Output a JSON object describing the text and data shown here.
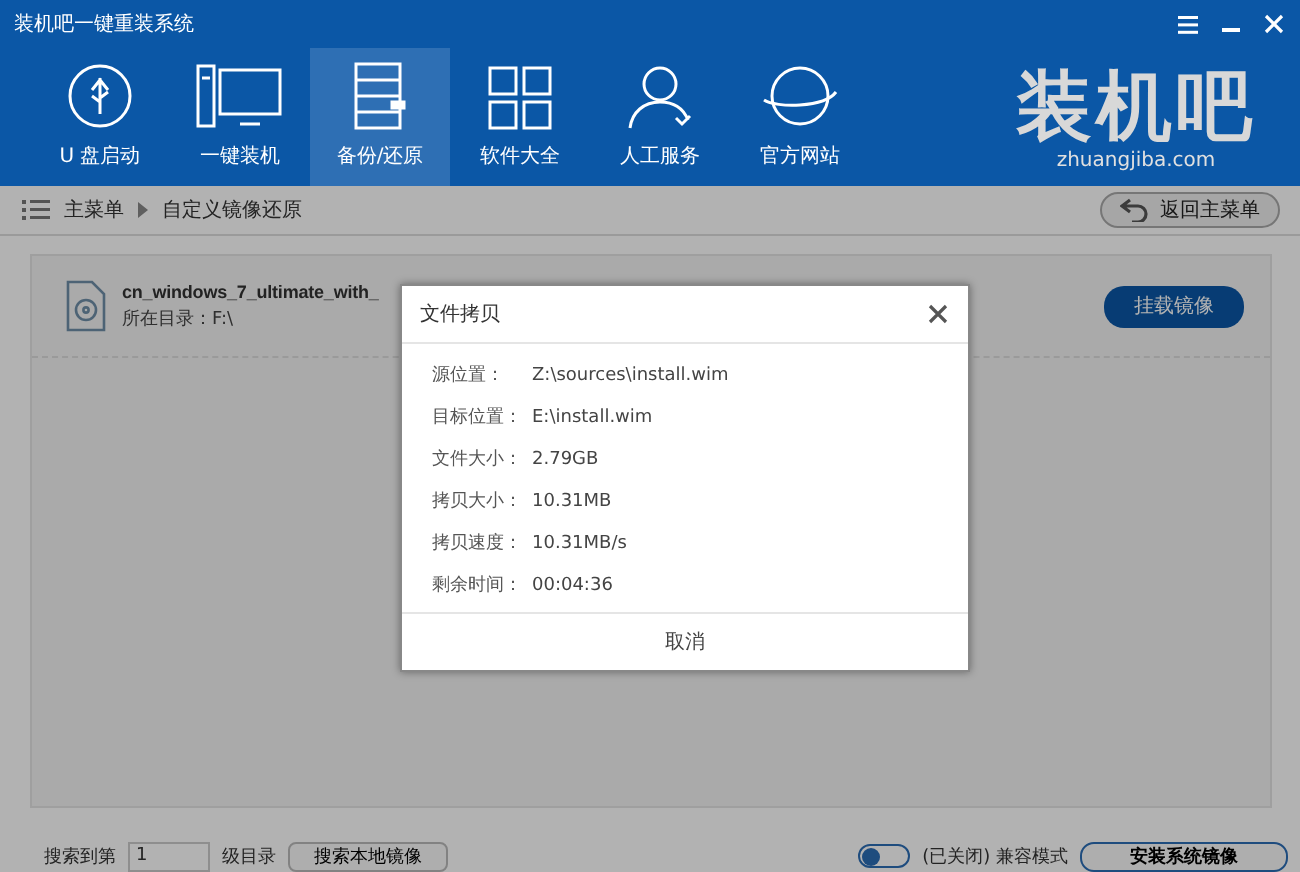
{
  "window": {
    "title": "装机吧一键重装系统"
  },
  "nav": [
    {
      "label": "U 盘启动",
      "selected": false
    },
    {
      "label": "一键装机",
      "selected": false
    },
    {
      "label": "备份/还原",
      "selected": true
    },
    {
      "label": "软件大全",
      "selected": false
    },
    {
      "label": "人工服务",
      "selected": false
    },
    {
      "label": "官方网站",
      "selected": false
    }
  ],
  "logo": {
    "name": "装机吧",
    "site": "zhuangjiba.com"
  },
  "breadcrumb": {
    "items": [
      "主菜单",
      "自定义镜像还原"
    ],
    "back_button": "返回主菜单"
  },
  "image_item": {
    "name": "cn_windows_7_ultimate_with_",
    "directory": "所在目录：F:\\",
    "button": "挂载镜像"
  },
  "dialog": {
    "title": "文件拷贝",
    "rows": [
      {
        "label": "源位置：",
        "value": "Z:\\sources\\install.wim"
      },
      {
        "label": "目标位置：",
        "value": "E:\\install.wim"
      },
      {
        "label": "文件大小：",
        "value": "2.79GB"
      },
      {
        "label": "拷贝大小：",
        "value": "10.31MB"
      },
      {
        "label": "拷贝速度：",
        "value": "10.31MB/s"
      },
      {
        "label": "剩余时间：",
        "value": "00:04:36"
      }
    ],
    "cancel": "取消"
  },
  "bottom_bar": {
    "search_prefix": "搜索到第",
    "depth": "1",
    "search_suffix": "级目录",
    "search_button": "搜索本地镜像",
    "compat_toggle": {
      "on": false,
      "label": "(已关闭) 兼容模式"
    },
    "install_button": "安装系统镜像"
  }
}
